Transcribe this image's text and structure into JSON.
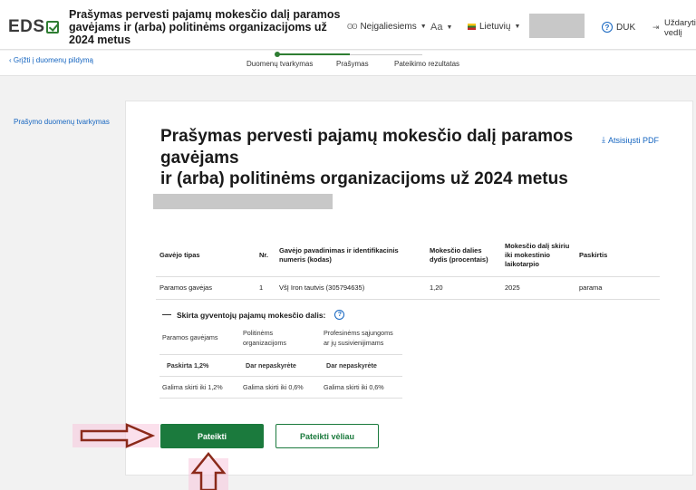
{
  "header": {
    "logo_text": "EDS",
    "title": "Prašymas pervesti pajamų mokesčio dalį paramos gavėjams ir (arba) politinėms organizacijoms už 2024 metus",
    "accessibility_label": "Neįgaliesiems",
    "font_size_label": "Aa",
    "language_label": "Lietuvių",
    "help_label": "DUK",
    "close_label": "Uždaryti vedlį"
  },
  "stepbar": {
    "back_label": "Grįžti į duomenų pildymą",
    "steps": [
      "Duomenų tvarkymas",
      "Prašymas",
      "Pateikimo rezultatas"
    ]
  },
  "left_nav": {
    "item": "Prašymo duomenų tvarkymas"
  },
  "document": {
    "title_line1": "Prašymas pervesti pajamų mokesčio dalį paramos gavėjams",
    "title_line2": "ir (arba) politinėms organizacijoms už 2024 metus",
    "pdf_label": "Atsisiųsti PDF"
  },
  "table": {
    "headers": [
      "Gavėjo tipas",
      "Nr.",
      "Gavėjo pavadinimas ir identifikacinis numeris (kodas)",
      "Mokesčio dalies dydis (procentais)",
      "Mokesčio dalį skiriu iki mokestinio laikotarpio",
      "Paskirtis"
    ],
    "rows": [
      [
        "Paramos gavėjas",
        "1",
        "VšĮ Iron tautvis (305794635)",
        "1,20",
        "2025",
        "parama"
      ]
    ]
  },
  "allocation": {
    "heading": "Skirta gyventojų pajamų mokesčio dalis:",
    "columns": [
      "Paramos gavėjams",
      "Politinėms organizacijoms",
      "Profesinėms sąjungoms ar jų susivienijimams"
    ],
    "status": [
      "Paskirta 1,2%",
      "Dar nepaskyrėte",
      "Dar nepaskyrėte"
    ],
    "limits": [
      "Galima skirti iki 1,2%",
      "Galima skirti iki 0,6%",
      "Galima skirti iki 0,6%"
    ]
  },
  "actions": {
    "submit_label": "Pateikti",
    "later_label": "Pateikti vėliau"
  },
  "colors": {
    "brand_green": "#1b7a3d",
    "link_blue": "#1565c0",
    "error_red": "#c62828",
    "annotation_arrow": "#8b2a1a"
  }
}
